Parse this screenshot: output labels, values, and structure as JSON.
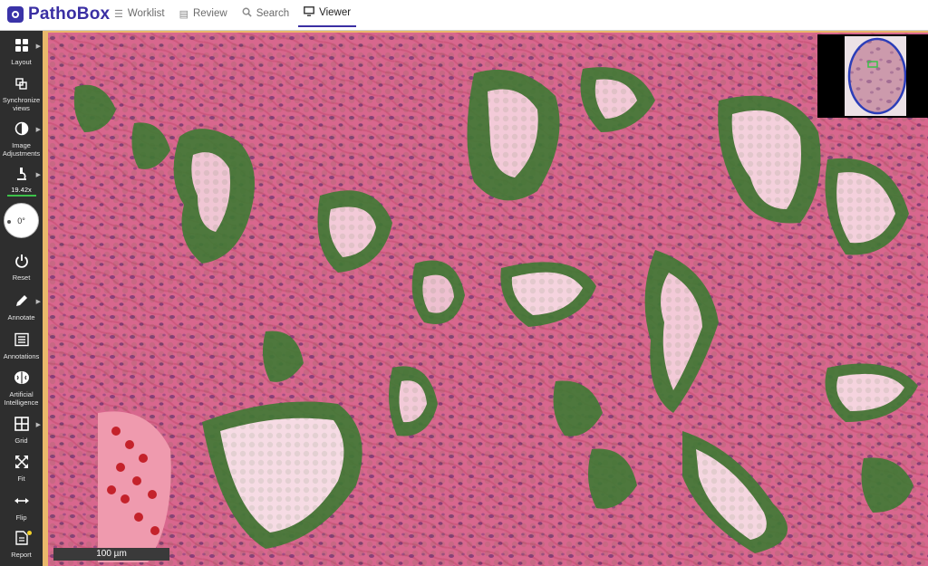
{
  "app": {
    "brand": "PathoBox"
  },
  "nav": {
    "tabs": [
      {
        "label": "Worklist",
        "icon": "list-icon",
        "active": false
      },
      {
        "label": "Review",
        "icon": "document-icon",
        "active": false
      },
      {
        "label": "Search",
        "icon": "search-icon",
        "active": false
      },
      {
        "label": "Viewer",
        "icon": "monitor-icon",
        "active": true
      }
    ]
  },
  "sidebar": {
    "layout": "Layout",
    "sync": "Synchronize views",
    "image_adjust": "Image Adjustments",
    "zoom": "19.42x",
    "rotation": "0°",
    "reset": "Reset",
    "annotate": "Annotate",
    "annotations": "Annotations",
    "ai": "Artificial Intelligence",
    "grid": "Grid",
    "fit": "Fit",
    "flip": "Flip",
    "report": "Report"
  },
  "viewer": {
    "scale": "100 µm"
  },
  "colors": {
    "brand": "#3a2fa3",
    "sidebar_bg": "#2e2e2e",
    "tissue_pink": "#d96a8f",
    "gland_highlight": "#3f7a34",
    "zoom_bar": "#3cc24a",
    "border_accent": "#e9b86b"
  }
}
